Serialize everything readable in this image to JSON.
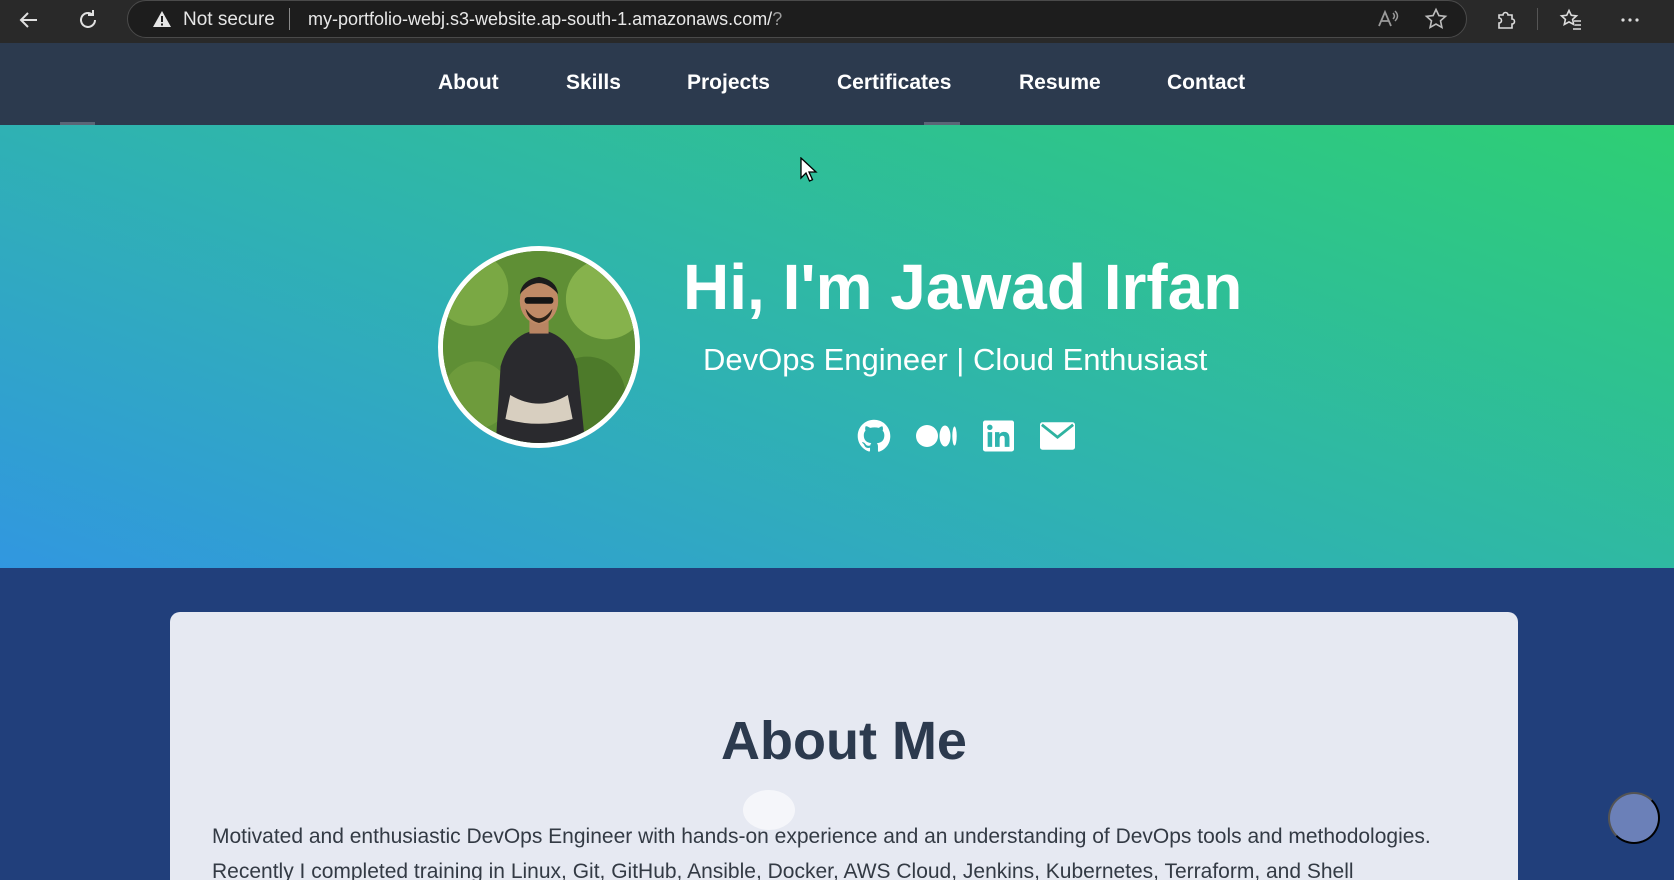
{
  "browser": {
    "security_label": "Not secure",
    "url_main": "my-portfolio-webj.s3-website.ap-south-1.amazonaws.com/",
    "url_suffix": "?"
  },
  "nav": {
    "items": [
      {
        "label": "About"
      },
      {
        "label": "Skills"
      },
      {
        "label": "Projects"
      },
      {
        "label": "Certificates"
      },
      {
        "label": "Resume"
      },
      {
        "label": "Contact"
      }
    ]
  },
  "hero": {
    "title": "Hi, I'm Jawad Irfan",
    "subtitle": "DevOps Engineer | Cloud Enthusiast",
    "social_icons": [
      "github-icon",
      "medium-icon",
      "linkedin-icon",
      "email-icon"
    ]
  },
  "about": {
    "title": "About Me",
    "text": "Motivated and enthusiastic DevOps Engineer with hands-on experience and an understanding of DevOps tools and methodologies. Recently I completed training in Linux, Git, GitHub, Ansible, Docker, AWS Cloud, Jenkins, Kubernetes, Terraform, and Shell"
  },
  "colors": {
    "nav_bg": "#2c3a4e",
    "hero_gradient_start": "#3197e0",
    "hero_gradient_end": "#2ecf73",
    "page_bg": "#213f7b",
    "card_bg": "#e6e9f2"
  }
}
